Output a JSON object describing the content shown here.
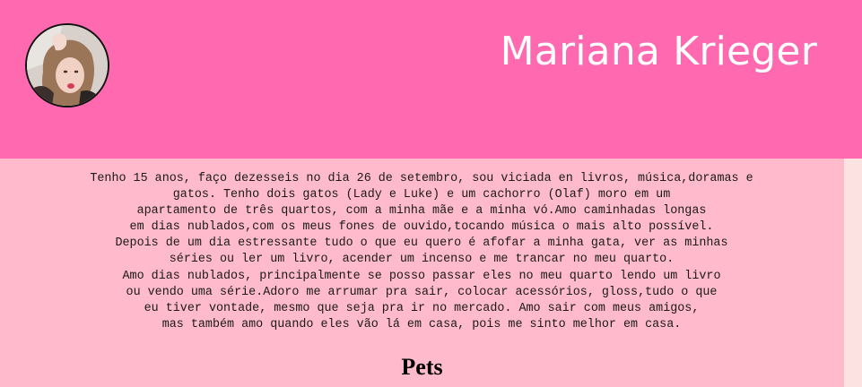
{
  "header": {
    "title": "Mariana Krieger",
    "avatar_icon": "profile-photo",
    "background_color": "#ff69b0",
    "title_color": "#ffffff"
  },
  "bio": {
    "lines": [
      "Tenho 15 anos, faço dezesseis no dia 26 de setembro, sou viciada en livros, música,doramas e",
      "gatos. Tenho dois gatos (Lady e Luke) e um cachorro (Olaf) moro em um",
      "apartamento de três quartos, com a minha mãe e a minha vó.Amo caminhadas longas",
      "em dias nublados,com os meus fones de ouvido,tocando música o mais alto possível.",
      "Depois de um dia estressante tudo o que eu quero é afofar a minha gata, ver as minhas",
      "séries ou ler um livro, acender um incenso e me trancar no meu quarto.",
      "Amo dias nublados, principalmente se posso passar eles no meu quarto lendo um livro",
      "ou vendo uma série.Adoro me arrumar pra sair, colocar acessórios, gloss,tudo o que",
      "eu tiver vontade, mesmo que seja pra ir no mercado. Amo sair com meus amigos,",
      "mas também amo quando eles vão lá em casa, pois me sinto melhor em casa."
    ]
  },
  "sections": {
    "pets_heading": "Pets"
  },
  "colors": {
    "content_background": "#ffbbcb",
    "scrollbar_strip": "#fde2e2"
  }
}
